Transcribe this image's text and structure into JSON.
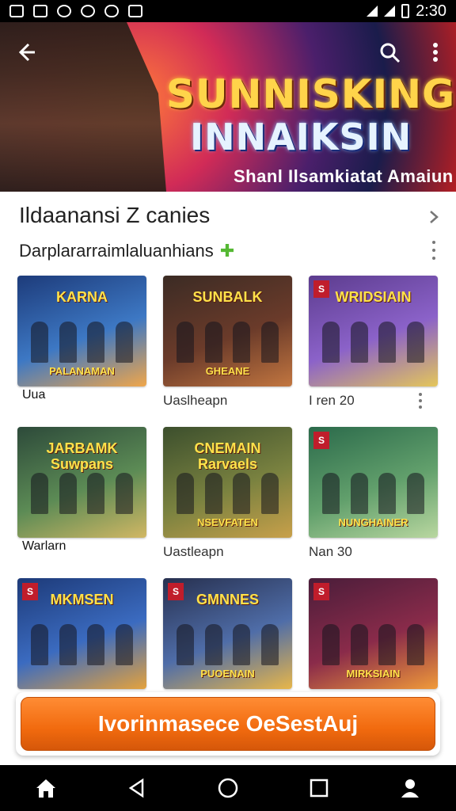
{
  "status_bar": {
    "time": "2:30",
    "icons": [
      "gallery-icon",
      "no-image-icon",
      "vpn-icon",
      "sync-icon",
      "message-icon",
      "tv-icon",
      "vibrate-icon"
    ]
  },
  "hero": {
    "title_line1": "SUNNISKING",
    "title_line2": "INNAIKSIN",
    "subtitle": "Shanl Ilsamkiatat Amaiun",
    "back_icon": "arrow-left-icon",
    "search_icon": "search-icon",
    "more_icon": "more-vertical-icon"
  },
  "section": {
    "title": "Ildaanansi Z canies",
    "subtitle": "Darplararraimlaluanhians",
    "subtitle_icon": "plus-icon"
  },
  "games": [
    {
      "art_title": "KARNA",
      "art_bottom": "PALANAMAN",
      "label": "Uua",
      "label_inset": true,
      "badge": "",
      "color1": "#1d3b7a",
      "color2": "#3d78c4",
      "color3": "#f0a64a"
    },
    {
      "art_title": "SUNBALK",
      "art_bottom": "GHEANE",
      "label": "Uaslheapn",
      "label_inset": false,
      "badge": "",
      "color1": "#3b2b24",
      "color2": "#6b3b2a",
      "color3": "#c27640"
    },
    {
      "art_title": "WRIDSIAIN",
      "art_bottom": "",
      "label": "I ren 20",
      "label_inset": false,
      "badge": "S",
      "color1": "#5c3c8e",
      "color2": "#8b62c9",
      "color3": "#e4c65a"
    },
    {
      "art_title": "JARBAMK Suwpans",
      "art_bottom": "",
      "label": "Warlarn",
      "label_inset": true,
      "badge": "",
      "color1": "#2d4a3a",
      "color2": "#5c8b55",
      "color3": "#d1b764"
    },
    {
      "art_title": "CNEMAIN Rarvaels",
      "art_bottom": "NSEVFATEN",
      "label": "Uastleapn",
      "label_inset": false,
      "badge": "",
      "color1": "#3c4f2d",
      "color2": "#7a8240",
      "color3": "#c8a04a"
    },
    {
      "art_title": "",
      "art_bottom": "NUNGHAINER",
      "label": "Nan 30",
      "label_inset": false,
      "badge": "S",
      "color1": "#2b6a4b",
      "color2": "#62a06c",
      "color3": "#b9d7a0"
    },
    {
      "art_title": "MKMSEN",
      "art_bottom": "",
      "label": "",
      "label_inset": false,
      "badge": "S",
      "color1": "#1d3a78",
      "color2": "#3b6bc0",
      "color3": "#e4a23d"
    },
    {
      "art_title": "GMNNES",
      "art_bottom": "PUOENAIN",
      "label": "",
      "label_inset": false,
      "badge": "S",
      "color1": "#27304f",
      "color2": "#4f6da8",
      "color3": "#e7b64a"
    },
    {
      "art_title": "",
      "art_bottom": "MIRKSIAIN",
      "label": "",
      "label_inset": false,
      "badge": "S",
      "color1": "#4a1d3a",
      "color2": "#8a2b4a",
      "color3": "#f09a3a"
    }
  ],
  "cta": {
    "label": "Ivorinmasece OeSestAuj"
  },
  "nav": {
    "items": [
      "home-icon",
      "back-triangle-icon",
      "home-circle-icon",
      "recents-square-icon",
      "profile-icon"
    ]
  }
}
